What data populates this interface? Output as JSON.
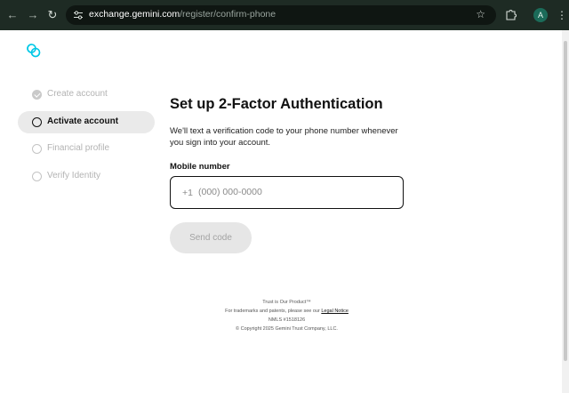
{
  "browser": {
    "url_host": "exchange.gemini.com",
    "url_path": "/register/confirm-phone",
    "profile_initial": "A",
    "icons": {
      "back": "arrow-left-icon",
      "forward": "arrow-right-icon",
      "reload": "reload-icon",
      "site_info": "tune-icon",
      "bookmark": "star-icon",
      "extensions": "puzzle-icon",
      "menu": "kebab-menu-icon"
    }
  },
  "brand": {
    "logo_icon": "gemini-logo-icon",
    "accent_color": "#00dcfa"
  },
  "steps": [
    {
      "label": "Create account",
      "state": "done"
    },
    {
      "label": "Activate account",
      "state": "active"
    },
    {
      "label": "Financial profile",
      "state": "todo"
    },
    {
      "label": "Verify Identity",
      "state": "todo"
    }
  ],
  "main": {
    "title": "Set up 2-Factor Authentication",
    "description": "We'll text a verification code to your phone number whenever you sign into your account.",
    "mobile_label": "Mobile number",
    "country_code": "+1",
    "phone_placeholder": "(000) 000-0000",
    "phone_value": "",
    "send_button": "Send code"
  },
  "footer": {
    "tagline": "Trust is Our Product™",
    "trademarks_text": "For trademarks and patents, please see our",
    "legal_link": "Legal Notice",
    "nmls": "NMLS #1518126",
    "copyright": "© Copyright 2025 Gemini Trust Company, LLC."
  }
}
